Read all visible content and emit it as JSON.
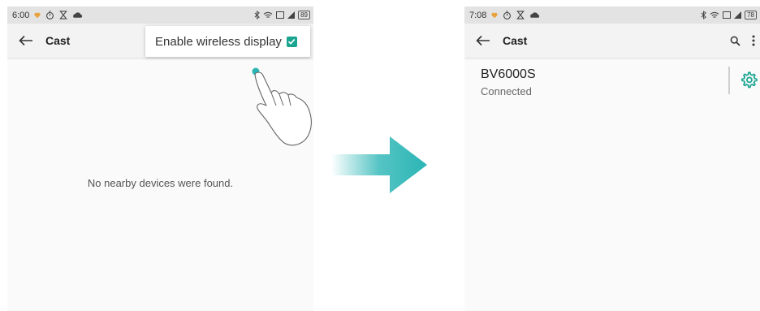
{
  "left_screen": {
    "status_bar": {
      "time": "6:00",
      "battery": "89"
    },
    "app_bar": {
      "title": "Cast"
    },
    "menu": {
      "enable_wireless_label": "Enable wireless display",
      "checked": true
    },
    "empty_message": "No nearby devices were found."
  },
  "right_screen": {
    "status_bar": {
      "time": "7:08",
      "battery": "78"
    },
    "app_bar": {
      "title": "Cast"
    },
    "device": {
      "name": "BV6000S",
      "status": "Connected"
    }
  },
  "colors": {
    "accent": "#1aa591",
    "arrow": "#2bb5b5"
  },
  "icons": [
    "back-arrow-icon",
    "search-icon",
    "more-vert-icon",
    "settings-gear-icon",
    "bluetooth-icon",
    "wifi-icon",
    "signal-icon",
    "battery-icon",
    "hand-pointer-icon"
  ]
}
